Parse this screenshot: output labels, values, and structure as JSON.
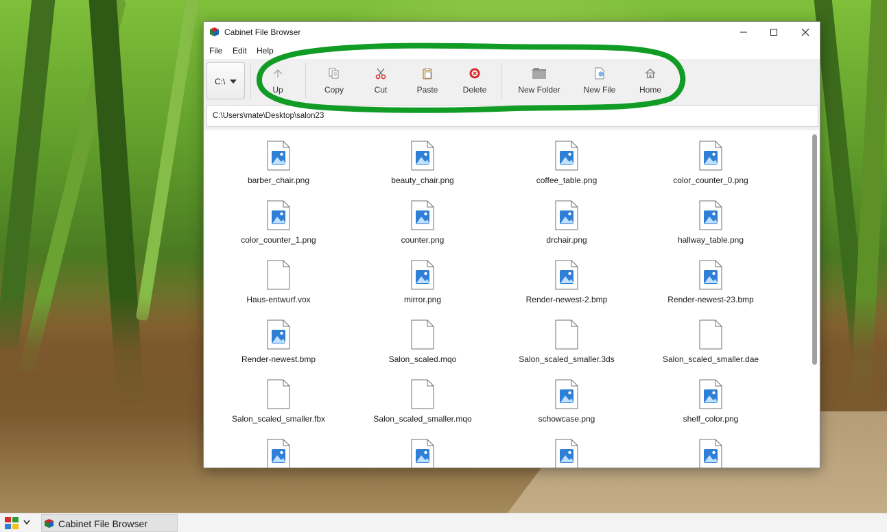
{
  "window": {
    "title": "Cabinet File Browser",
    "menu": [
      "File",
      "Edit",
      "Help"
    ]
  },
  "toolbar": {
    "drive": "C:\\",
    "buttons": [
      {
        "label": "Up",
        "icon": "up-arrow-icon"
      },
      {
        "label": "Copy",
        "icon": "copy-icon"
      },
      {
        "label": "Cut",
        "icon": "scissors-icon"
      },
      {
        "label": "Paste",
        "icon": "paste-icon"
      },
      {
        "label": "Delete",
        "icon": "delete-icon"
      },
      {
        "label": "New Folder",
        "icon": "folder-icon"
      },
      {
        "label": "New File",
        "icon": "new-file-icon"
      },
      {
        "label": "Home",
        "icon": "home-icon"
      }
    ]
  },
  "path": "C:\\Users\\mate\\Desktop\\salon23",
  "files": [
    {
      "name": "barber_chair.png",
      "kind": "image"
    },
    {
      "name": "beauty_chair.png",
      "kind": "image"
    },
    {
      "name": "coffee_table.png",
      "kind": "image"
    },
    {
      "name": "color_counter_0.png",
      "kind": "image"
    },
    {
      "name": "color_counter_1.png",
      "kind": "image"
    },
    {
      "name": "counter.png",
      "kind": "image"
    },
    {
      "name": "drchair.png",
      "kind": "image"
    },
    {
      "name": "hallway_table.png",
      "kind": "image"
    },
    {
      "name": "Haus-entwurf.vox",
      "kind": "blank"
    },
    {
      "name": "mirror.png",
      "kind": "image"
    },
    {
      "name": "Render-newest-2.bmp",
      "kind": "image"
    },
    {
      "name": "Render-newest-23.bmp",
      "kind": "image"
    },
    {
      "name": "Render-newest.bmp",
      "kind": "image"
    },
    {
      "name": "Salon_scaled.mqo",
      "kind": "blank"
    },
    {
      "name": "Salon_scaled_smaller.3ds",
      "kind": "blank"
    },
    {
      "name": "Salon_scaled_smaller.dae",
      "kind": "blank"
    },
    {
      "name": "Salon_scaled_smaller.fbx",
      "kind": "blank"
    },
    {
      "name": "Salon_scaled_smaller.mqo",
      "kind": "blank"
    },
    {
      "name": "schowcase.png",
      "kind": "image"
    },
    {
      "name": "shelf_color.png",
      "kind": "image"
    },
    {
      "name": "",
      "kind": "image"
    },
    {
      "name": "",
      "kind": "image"
    },
    {
      "name": "",
      "kind": "image"
    },
    {
      "name": "",
      "kind": "image"
    }
  ],
  "taskbar": {
    "item_label": "Cabinet File Browser"
  },
  "colors": {
    "highlight": "#119c25",
    "image_icon": "#2f7fd6",
    "delete_red": "#d9262b"
  }
}
